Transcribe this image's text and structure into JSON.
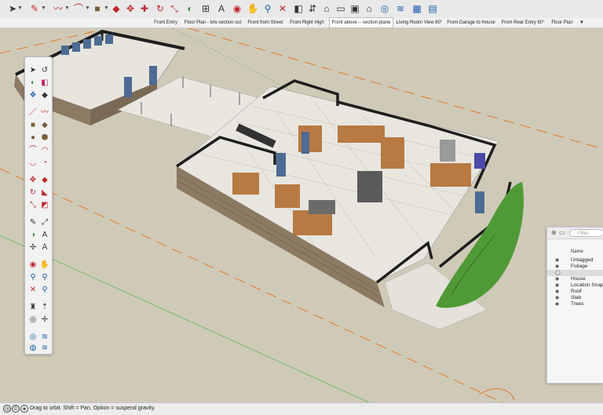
{
  "toolbar": {
    "icons": [
      "select-icon",
      "eraser-icon",
      "line-icon",
      "arc-icon",
      "shapes-icon",
      "push-pull-icon",
      "move-icon",
      "rotate-icon",
      "paint-bucket-icon",
      "dimension-icon",
      "text-icon",
      "orbit-icon",
      "pan-icon",
      "zoom-icon",
      "zoom-extents-icon",
      "camera-icon",
      "home-icon",
      "warehouse-icon",
      "extension-icon",
      "components-icon",
      "styles-icon",
      "sandbox-icon",
      "layers-icon"
    ]
  },
  "scenes": {
    "tabs": [
      "Front Entry",
      "Floor Plan - b/w section cut",
      "Front from Street",
      "Front Right High",
      "Front above -- section plane",
      "Living Room View 60°",
      "From Garage to House",
      "From Rear Entry 60°",
      "Floor Plan"
    ],
    "active_index": 4,
    "more_label": "▼"
  },
  "tags_panel": {
    "filter_placeholder": "Filter",
    "column_header": "Name",
    "items": [
      "Untagged",
      "Foliage",
      "",
      "House",
      "Location Snap",
      "Roof",
      "Slab",
      "Trees"
    ],
    "selected_index": 2
  },
  "statusbar": {
    "message": "Drag to orbit. Shift = Pan, Option = suspend gravity."
  },
  "colors": {
    "ground": "#cfcab8",
    "floor_tile": "#e8e6df",
    "wall_top": "#1e1e1e",
    "wall_stone": "#8c7a63",
    "cabinet": "#b77a43",
    "axis_red": "#e07a2a",
    "axis_green": "#76b86a",
    "foliage": "#4f9a36"
  }
}
